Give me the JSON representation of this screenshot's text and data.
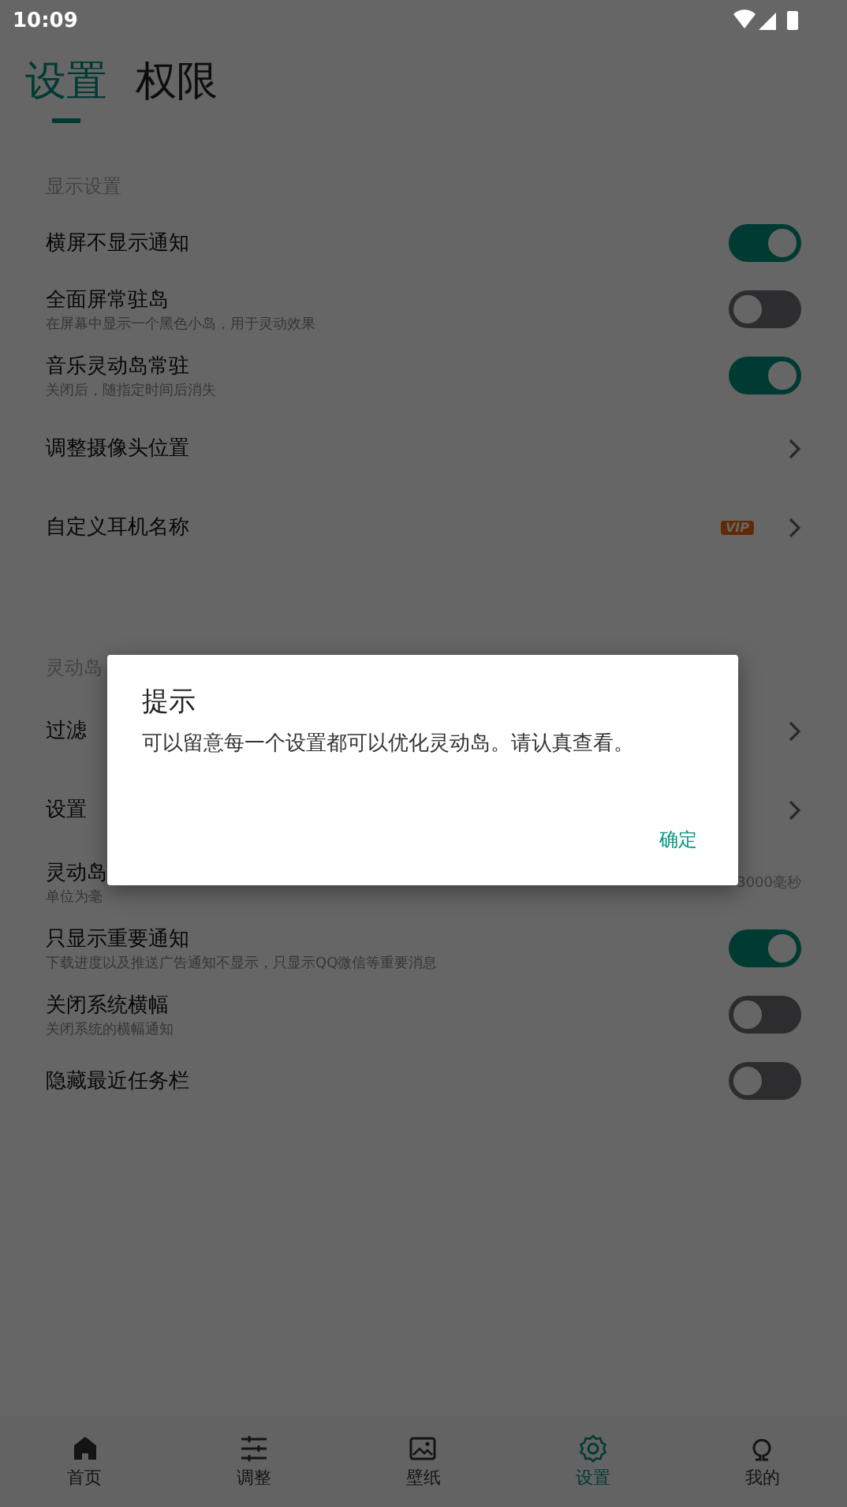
{
  "status_bar": {
    "time": "10:09"
  },
  "tabs": [
    {
      "label": "设置",
      "selected": true
    },
    {
      "label": "权限",
      "selected": false
    }
  ],
  "sections": [
    {
      "header": "显示设置",
      "rows": [
        {
          "kind": "toggle",
          "title": "横屏不显示通知",
          "on": true
        },
        {
          "kind": "toggle",
          "title": "全面屏常驻岛",
          "subtitle": "在屏幕中显示一个黑色小岛，用于灵动效果",
          "on": false
        },
        {
          "kind": "toggle",
          "title": "音乐灵动岛常驻",
          "subtitle": "关闭后，随指定时间后消失",
          "on": true
        },
        {
          "kind": "link",
          "title": "调整摄像头位置"
        },
        {
          "kind": "link",
          "title": "自定义耳机名称",
          "badge": "VIP"
        }
      ]
    },
    {
      "header": "灵动岛",
      "rows": [
        {
          "kind": "link",
          "title": "过滤"
        },
        {
          "kind": "link",
          "title": "设置"
        },
        {
          "kind": "value",
          "title": "灵动岛",
          "subtitle": "单位为毫",
          "value": "3000毫秒"
        },
        {
          "kind": "toggle",
          "title": "只显示重要通知",
          "subtitle": "下载进度以及推送广告通知不显示，只显示QQ微信等重要消息",
          "on": true
        },
        {
          "kind": "toggle",
          "title": "关闭系统横幅",
          "subtitle": "关闭系统的横幅通知",
          "on": false
        },
        {
          "kind": "toggle",
          "title": "隐藏最近任务栏",
          "on": false
        }
      ]
    }
  ],
  "dialog": {
    "title": "提示",
    "message": "可以留意每一个设置都可以优化灵动岛。请认真查看。",
    "buttons": [
      "确定"
    ]
  },
  "bottom_nav": [
    {
      "label": "首页",
      "kind": "home",
      "selected": false
    },
    {
      "label": "调整",
      "kind": "sliders",
      "selected": false
    },
    {
      "label": "壁纸",
      "kind": "image",
      "selected": false
    },
    {
      "label": "设置",
      "kind": "gear",
      "selected": true
    },
    {
      "label": "我的",
      "kind": "person",
      "selected": false
    }
  ]
}
